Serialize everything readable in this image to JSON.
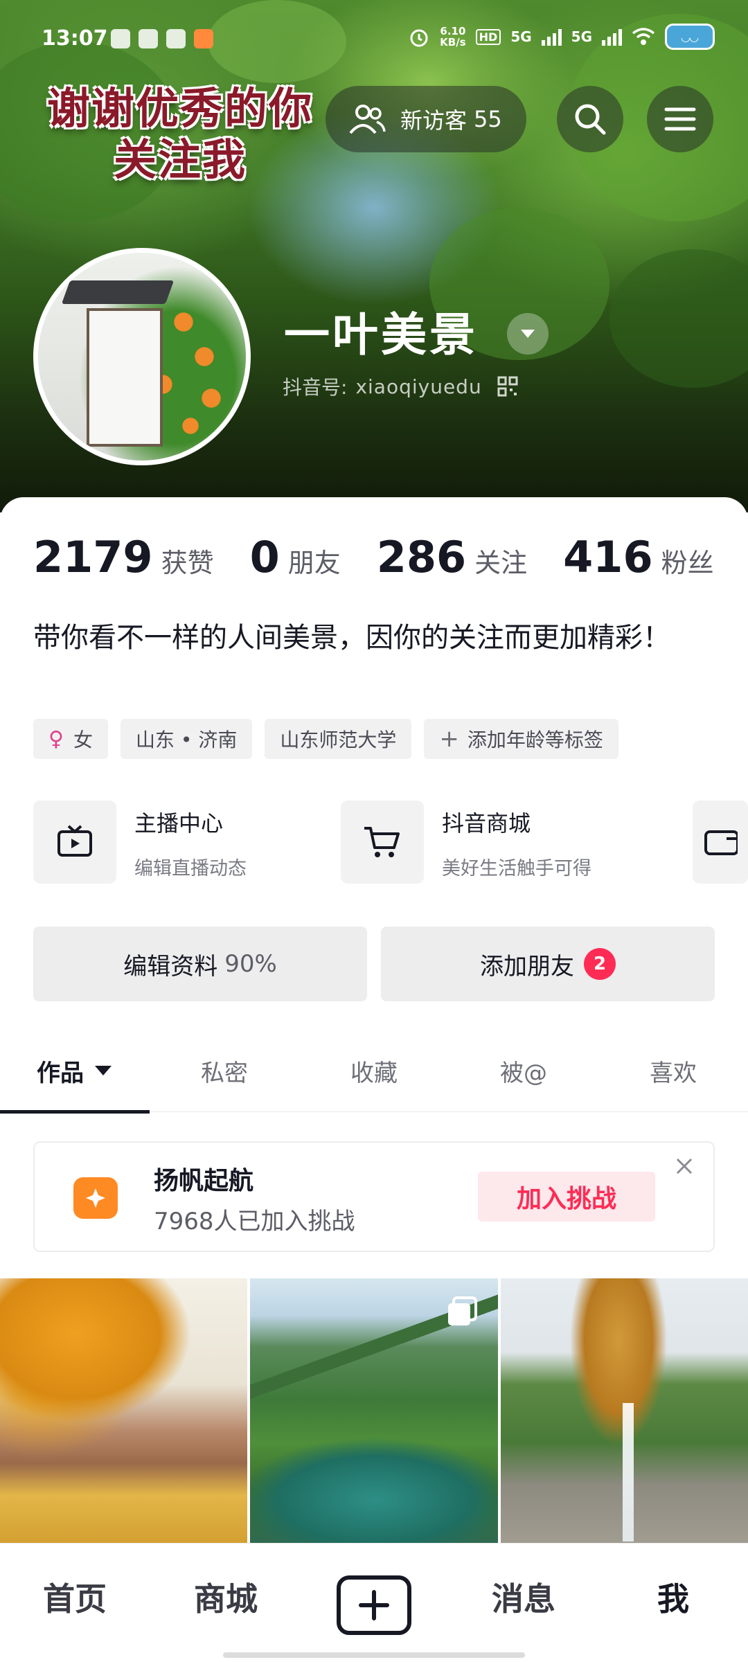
{
  "status_bar": {
    "time": "13:07",
    "net_speed": "6.10",
    "net_speed_unit": "KB/s",
    "network_1": "5G",
    "network_2": "5G",
    "hd_label": "HD"
  },
  "header": {
    "banner_line1": "谢谢优秀的你",
    "banner_line2": "关注我",
    "visitors_label": "新访客",
    "visitors_count": "55"
  },
  "profile": {
    "nickname": "一叶美景",
    "douyin_id_label": "抖音号:",
    "douyin_id": "xiaoqiyuedu"
  },
  "stats": [
    {
      "num": "2179",
      "label": "获赞"
    },
    {
      "num": "0",
      "label": "朋友"
    },
    {
      "num": "286",
      "label": "关注"
    },
    {
      "num": "416",
      "label": "粉丝"
    }
  ],
  "bio": "带你看不一样的人间美景，因你的关注而更加精彩！",
  "tags": {
    "gender": "女",
    "location": "山东 • 济南",
    "school": "山东师范大学",
    "add": "添加年龄等标签"
  },
  "services": [
    {
      "title": "主播中心",
      "sub": "编辑直播动态",
      "icon": "tv-icon"
    },
    {
      "title": "抖音商城",
      "sub": "美好生活触手可得",
      "icon": "cart-icon"
    }
  ],
  "actions": {
    "edit_label": "编辑资料",
    "edit_pct": "90%",
    "add_friend_label": "添加朋友",
    "add_friend_badge": "2"
  },
  "tabs": [
    "作品",
    "私密",
    "收藏",
    "被@",
    "喜欢"
  ],
  "challenge": {
    "title": "扬帆起航",
    "sub": "7968人已加入挑战",
    "join": "加入挑战"
  },
  "bottom_nav": [
    "首页",
    "商城",
    "消息",
    "我"
  ],
  "colors": {
    "accent": "#fe2c55",
    "text": "#161823",
    "challenge_icon": "#fe8a24"
  }
}
